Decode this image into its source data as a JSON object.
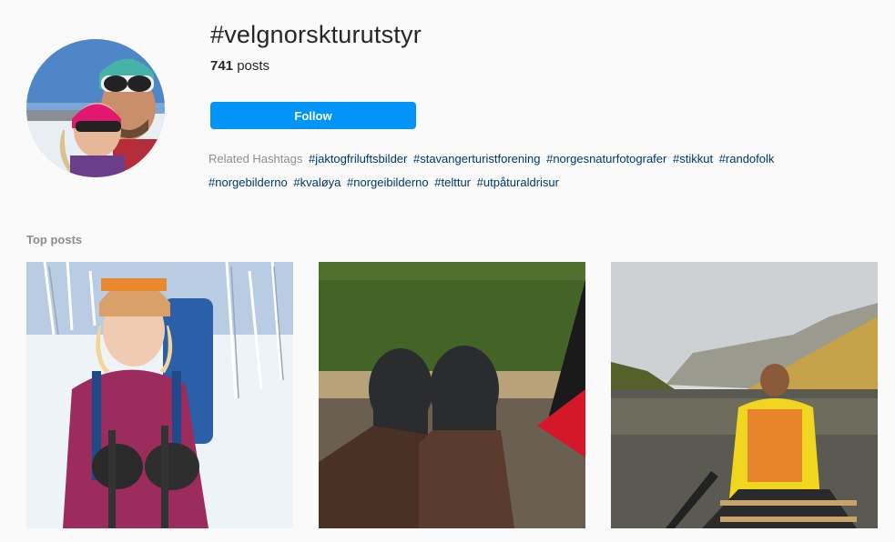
{
  "hashtag": {
    "title": "#velgnorskturutstyr",
    "post_count": "741",
    "post_count_suffix": " posts",
    "follow_label": "Follow"
  },
  "related": {
    "label": "Related Hashtags",
    "tags": [
      "#jaktogfriluftsbilder",
      "#stavangerturistforening",
      "#norgesnaturfotografer",
      "#stikkut",
      "#randofolk",
      "#norgebilderno",
      "#kvaløya",
      "#norgeibilderno",
      "#telttur",
      "#utpåturaldrisur"
    ]
  },
  "top_posts": {
    "label": "Top posts"
  },
  "colors": {
    "follow_button": "#0095f6",
    "hashtag_link": "#00376b",
    "muted_text": "#8e8e8e",
    "background": "#fafafa"
  }
}
